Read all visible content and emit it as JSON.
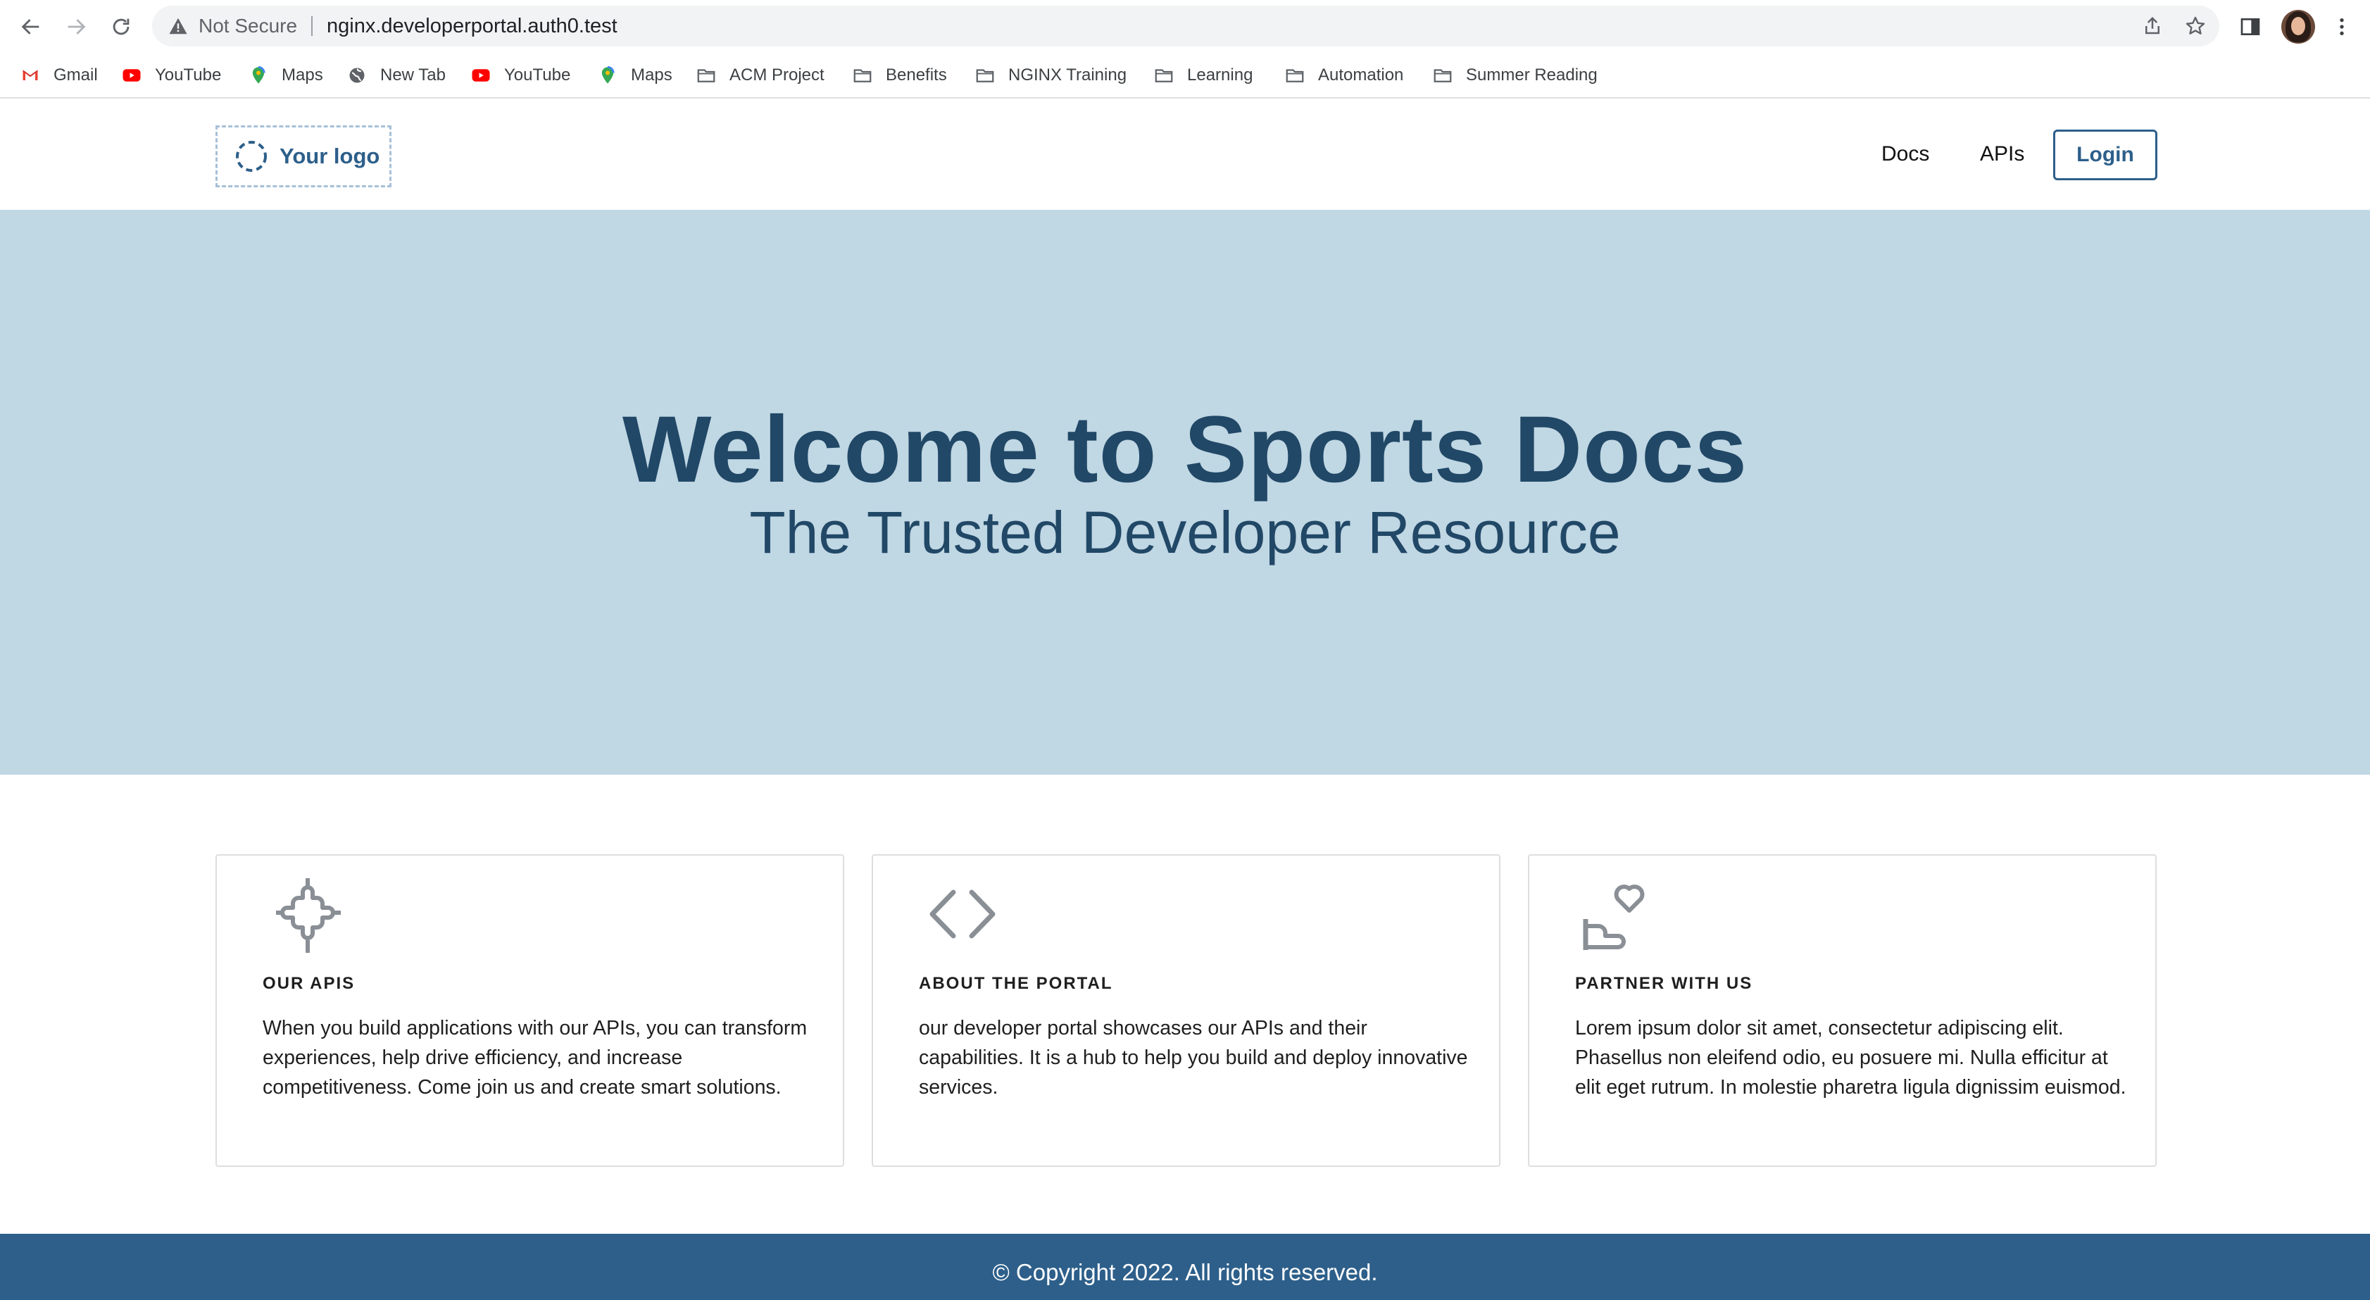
{
  "browser": {
    "security_label": "Not Secure",
    "url": "nginx.developerportal.auth0.test",
    "icons": {
      "back": "arrow-left-icon",
      "forward": "arrow-right-icon",
      "reload": "reload-icon",
      "warning": "warning-triangle-icon",
      "share": "share-icon",
      "bookmark": "star-icon",
      "side_panel": "side-panel-icon",
      "menu": "kebab-menu-icon"
    }
  },
  "bookmarks": [
    {
      "label": "Gmail",
      "icon": "gmail-icon"
    },
    {
      "label": "YouTube",
      "icon": "youtube-icon"
    },
    {
      "label": "Maps",
      "icon": "maps-pin-icon"
    },
    {
      "label": "New Tab",
      "icon": "globe-icon"
    },
    {
      "label": "YouTube",
      "icon": "youtube-icon"
    },
    {
      "label": "Maps",
      "icon": "maps-pin-icon"
    },
    {
      "label": "ACM Project",
      "icon": "folder-icon"
    },
    {
      "label": "Benefits",
      "icon": "folder-icon"
    },
    {
      "label": "NGINX Training",
      "icon": "folder-icon"
    },
    {
      "label": "Learning",
      "icon": "folder-icon"
    },
    {
      "label": "Automation",
      "icon": "folder-icon"
    },
    {
      "label": "Summer Reading",
      "icon": "folder-icon"
    }
  ],
  "header": {
    "logo_text": "Your logo",
    "nav": {
      "docs": "Docs",
      "apis": "APIs"
    },
    "login_label": "Login"
  },
  "hero": {
    "title": "Welcome to Sports Docs",
    "subtitle": "The Trusted Developer Resource"
  },
  "cards": [
    {
      "icon": "puzzle-cross-icon",
      "title": "OUR APIS",
      "text": "When you build applications with our APIs, you can transform experiences, help drive efficiency, and increase competitiveness. Come join us and create smart solutions."
    },
    {
      "icon": "code-brackets-icon",
      "title": "ABOUT THE PORTAL",
      "text": "our developer portal showcases our APIs and their capabilities. It is a hub to help you build and deploy innovative services."
    },
    {
      "icon": "hand-heart-icon",
      "title": "PARTNER WITH US",
      "text": "Lorem ipsum dolor sit amet, consectetur adipiscing elit. Phasellus non eleifend odio, eu posuere mi. Nulla efficitur at elit eget rutrum. In molestie pharetra ligula dignissim euismod."
    }
  ],
  "footer": {
    "copyright": "© Copyright 2022. All rights reserved."
  },
  "colors": {
    "brand": "#2d5f8a",
    "hero_bg": "#c0d7e4",
    "hero_text": "#214866"
  }
}
